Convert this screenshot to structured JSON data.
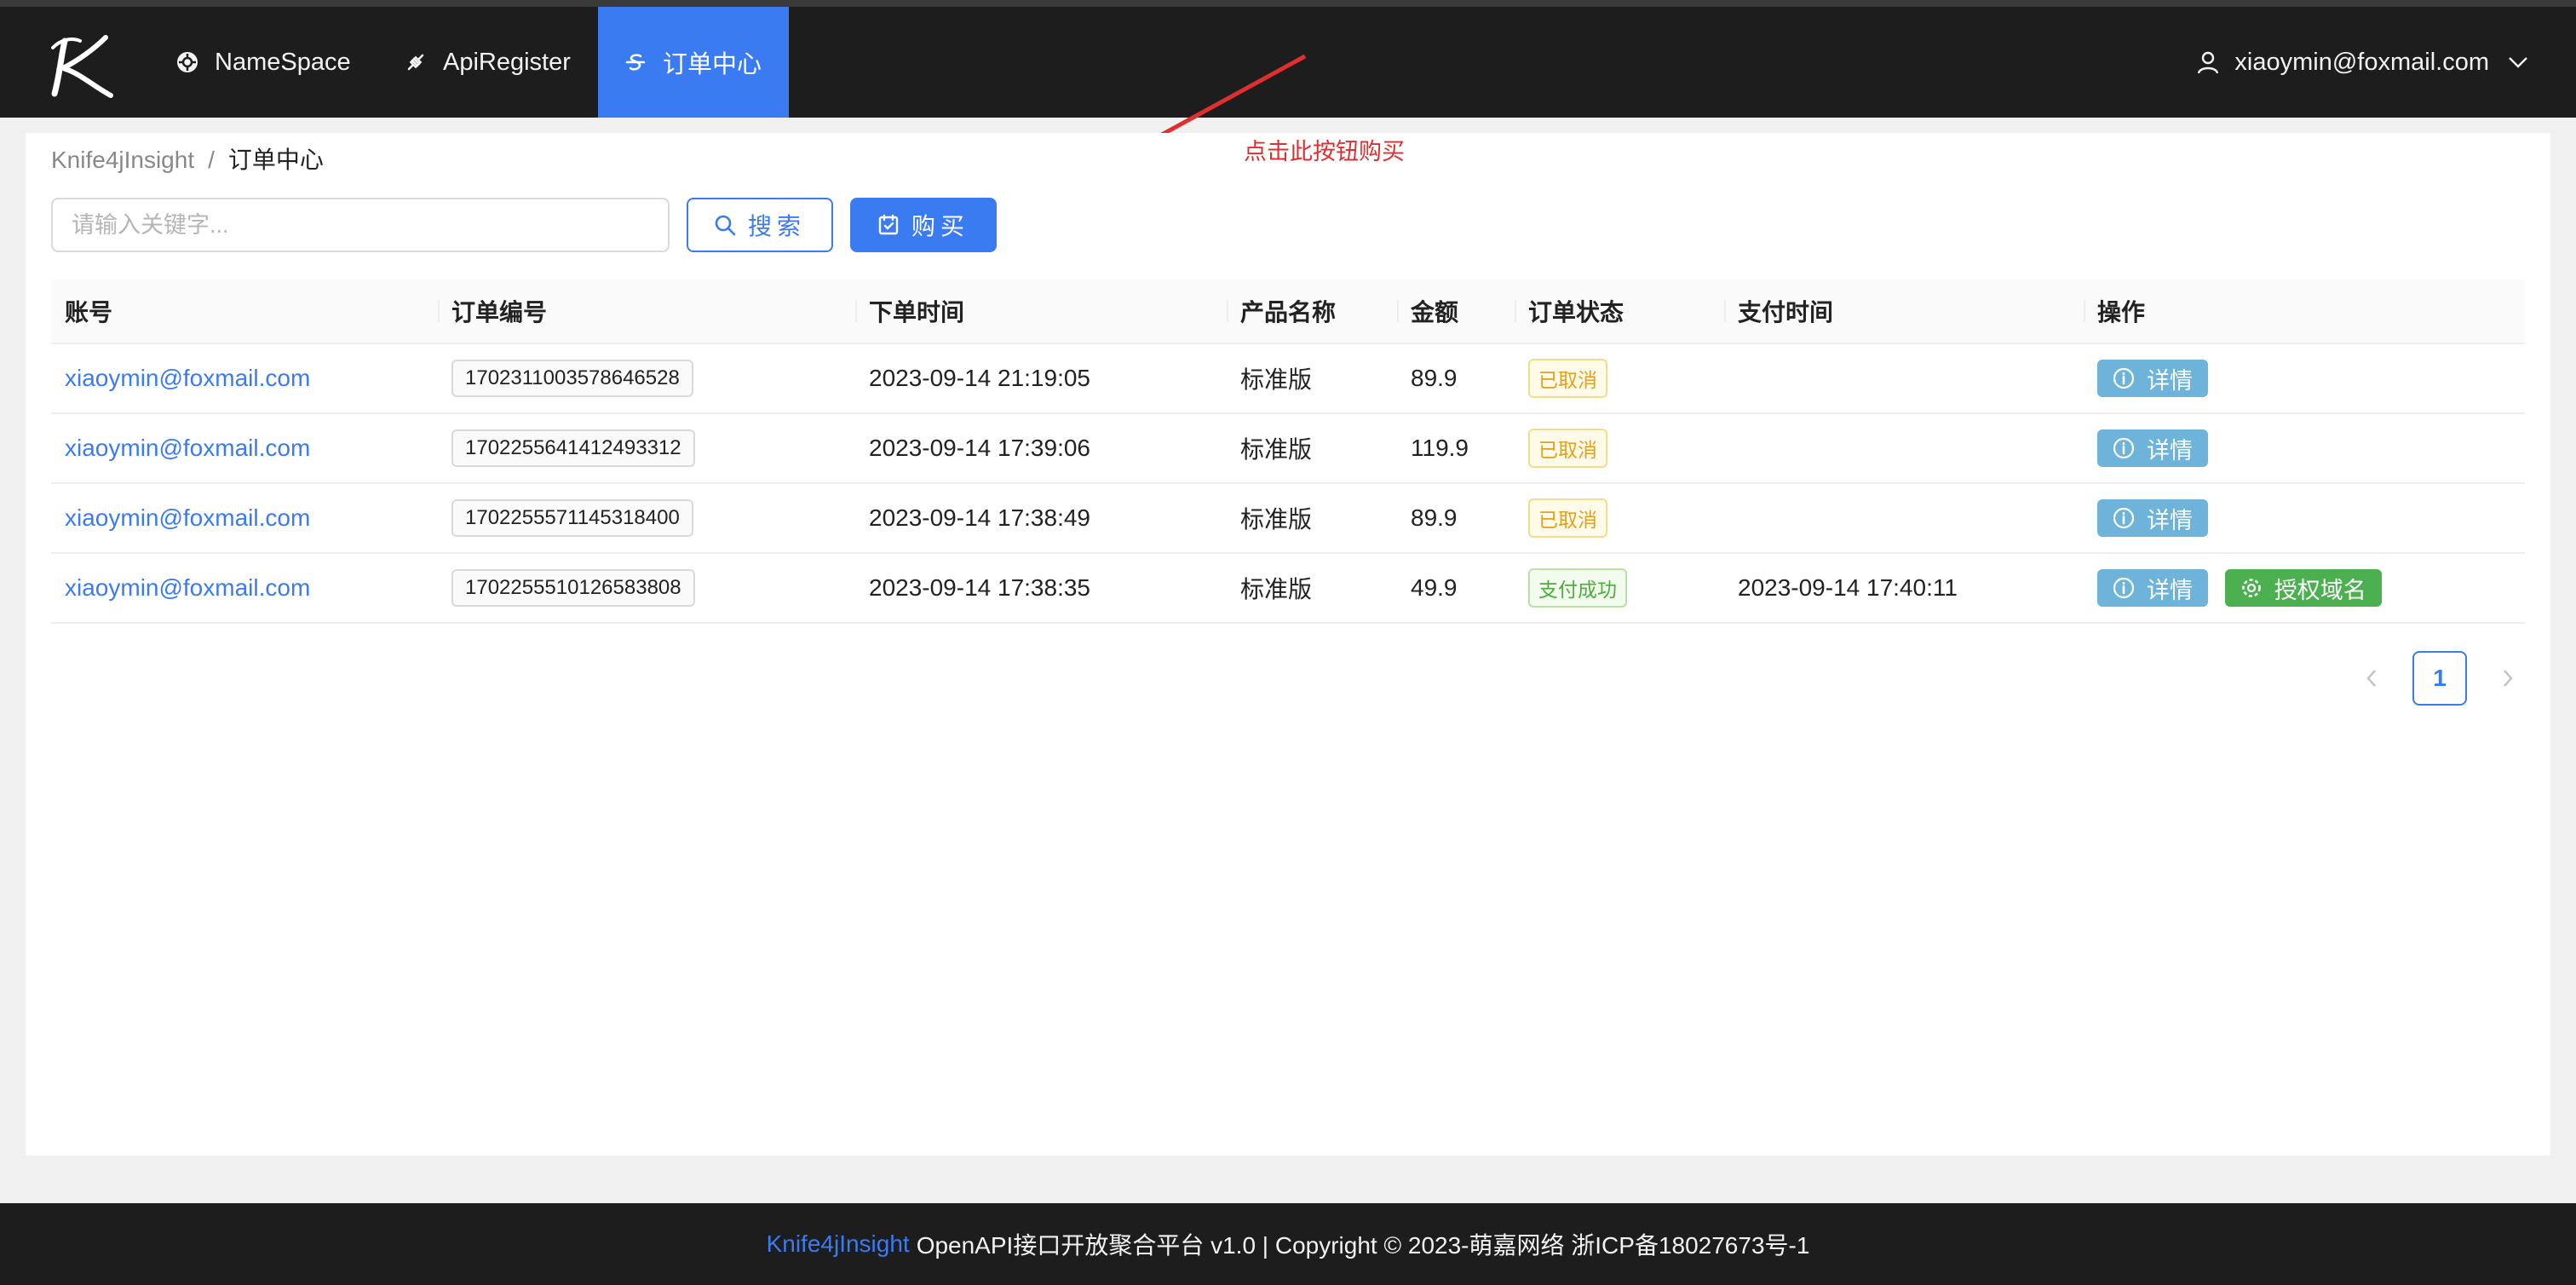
{
  "nav": {
    "logo_letter": "K",
    "items": [
      {
        "label": "NameSpace",
        "icon": "namespace-icon"
      },
      {
        "label": "ApiRegister",
        "icon": "api-icon"
      },
      {
        "label": "订单中心",
        "icon": "order-icon",
        "active": true
      }
    ],
    "user": "xiaoymin@foxmail.com"
  },
  "breadcrumb": {
    "root": "Knife4jInsight",
    "separator": "/",
    "current": "订单中心"
  },
  "annotation": {
    "text": "点击此按钮购买"
  },
  "toolbar": {
    "search_placeholder": "请输入关键字...",
    "search_label": "搜索",
    "buy_label": "购买"
  },
  "table": {
    "columns": [
      "账号",
      "订单编号",
      "下单时间",
      "产品名称",
      "金额",
      "订单状态",
      "支付时间",
      "操作"
    ],
    "rows": [
      {
        "account": "xiaoymin@foxmail.com",
        "order_no": "1702311003578646528",
        "time": "2023-09-14 21:19:05",
        "product": "标准版",
        "amount": "89.9",
        "status": "已取消",
        "pay_time": ""
      },
      {
        "account": "xiaoymin@foxmail.com",
        "order_no": "1702255641412493312",
        "time": "2023-09-14 17:39:06",
        "product": "标准版",
        "amount": "119.9",
        "status": "已取消",
        "pay_time": ""
      },
      {
        "account": "xiaoymin@foxmail.com",
        "order_no": "1702255571145318400",
        "time": "2023-09-14 17:38:49",
        "product": "标准版",
        "amount": "89.9",
        "status": "已取消",
        "pay_time": ""
      },
      {
        "account": "xiaoymin@foxmail.com",
        "order_no": "1702255510126583808",
        "time": "2023-09-14 17:38:35",
        "product": "标准版",
        "amount": "49.9",
        "status": "支付成功",
        "pay_time": "2023-09-14 17:40:11"
      }
    ],
    "actions": {
      "detail": "详情",
      "authorize": "授权域名"
    }
  },
  "pagination": {
    "current": "1"
  },
  "footer": {
    "brand": "Knife4jInsight",
    "text": "OpenAPI接口开放聚合平台 v1.0 | Copyright © 2023-萌嘉网络 浙ICP备18027673号-1"
  },
  "colors": {
    "primary": "#3b7bf2",
    "dark": "#1d1d1d",
    "annotation": "#e02f2f",
    "detail": "#6db3da",
    "success": "#4caf50",
    "warning": "#e0a020"
  }
}
